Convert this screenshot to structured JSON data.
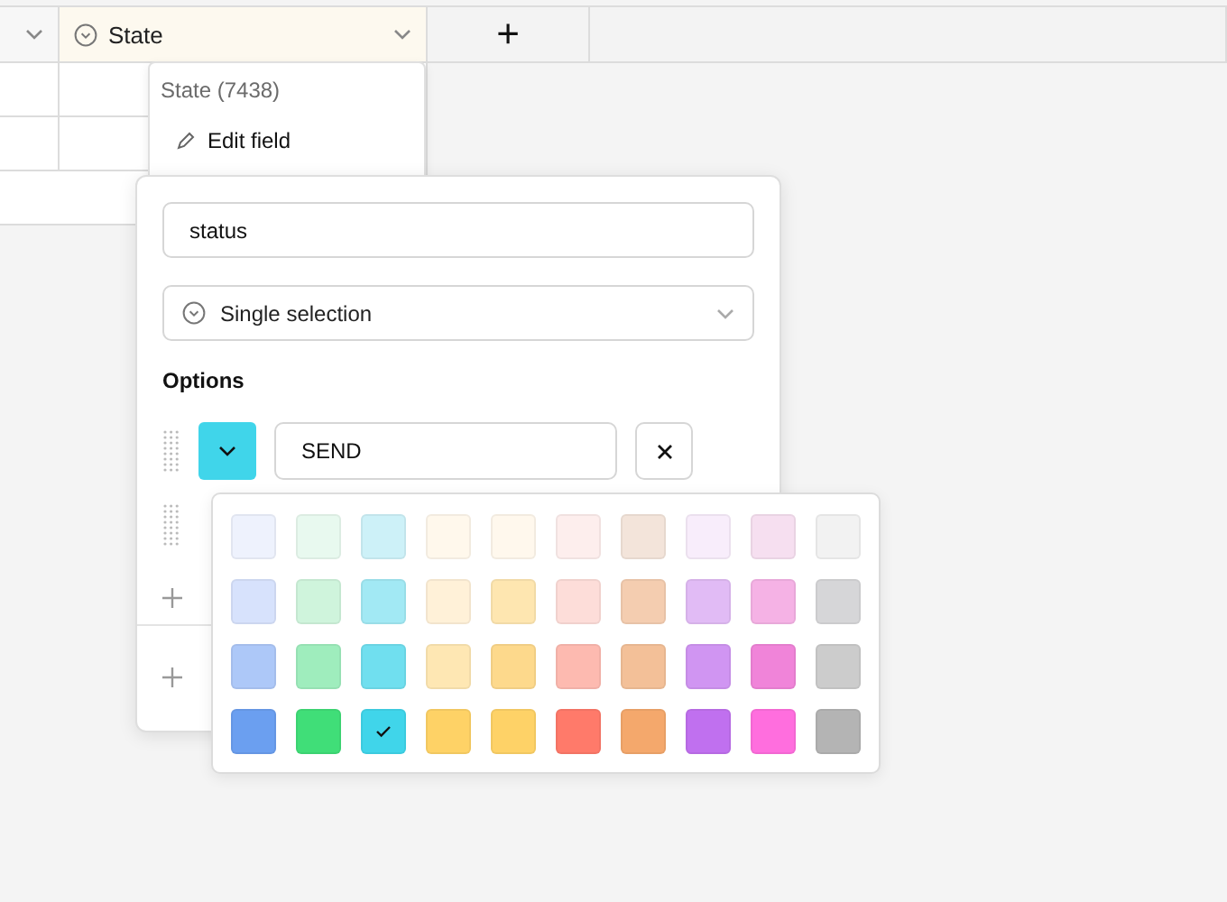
{
  "table": {
    "columns": [
      {
        "kind": "plain"
      },
      {
        "kind": "field",
        "label": "State"
      },
      {
        "kind": "add",
        "label": "+"
      }
    ]
  },
  "column_menu": {
    "title": "State (7438)",
    "items": [
      {
        "label": "Edit field"
      }
    ]
  },
  "field_editor": {
    "name": "status",
    "type": "Single selection",
    "options_heading": "Options",
    "options": [
      {
        "label": "SEND",
        "color": "#40d5ea"
      }
    ],
    "add_buttons": [
      {
        "kind": "option"
      },
      {
        "kind": "section"
      }
    ]
  },
  "color_picker": {
    "rows": [
      [
        {
          "color": "#eef2fd",
          "selected": false
        },
        {
          "color": "#e8f9ef",
          "selected": false
        },
        {
          "color": "#cdf1f8",
          "selected": false
        },
        {
          "color": "#fff8ec",
          "selected": false
        },
        {
          "color": "#fff8ed",
          "selected": false
        },
        {
          "color": "#fdeeed",
          "selected": false
        },
        {
          "color": "#f3e4da",
          "selected": false
        },
        {
          "color": "#f8edfb",
          "selected": false
        },
        {
          "color": "#f6dff0",
          "selected": false
        },
        {
          "color": "#f2f2f2",
          "selected": false
        }
      ],
      [
        {
          "color": "#d7e2fc",
          "selected": false
        },
        {
          "color": "#cff4dc",
          "selected": false
        },
        {
          "color": "#a2e9f4",
          "selected": false
        },
        {
          "color": "#fff1d8",
          "selected": false
        },
        {
          "color": "#fee6b0",
          "selected": false
        },
        {
          "color": "#fdddd9",
          "selected": false
        },
        {
          "color": "#f4cdb0",
          "selected": false
        },
        {
          "color": "#e1bbf5",
          "selected": false
        },
        {
          "color": "#f5b2e5",
          "selected": false
        },
        {
          "color": "#d6d6d8",
          "selected": false
        }
      ],
      [
        {
          "color": "#adc8f8",
          "selected": false
        },
        {
          "color": "#9fedbd",
          "selected": false
        },
        {
          "color": "#70dfef",
          "selected": false
        },
        {
          "color": "#fee7b3",
          "selected": false
        },
        {
          "color": "#fdd98c",
          "selected": false
        },
        {
          "color": "#fdbab0",
          "selected": false
        },
        {
          "color": "#f3c098",
          "selected": false
        },
        {
          "color": "#d095f2",
          "selected": false
        },
        {
          "color": "#f084d9",
          "selected": false
        },
        {
          "color": "#cccccc",
          "selected": false
        }
      ],
      [
        {
          "color": "#6b9ff0",
          "selected": false
        },
        {
          "color": "#40de78",
          "selected": false
        },
        {
          "color": "#40d5ea",
          "selected": true
        },
        {
          "color": "#fed266",
          "selected": false
        },
        {
          "color": "#fed267",
          "selected": false
        },
        {
          "color": "#ff7a6a",
          "selected": false
        },
        {
          "color": "#f4a86c",
          "selected": false
        },
        {
          "color": "#c070ef",
          "selected": false
        },
        {
          "color": "#ff6ede",
          "selected": false
        },
        {
          "color": "#b4b4b4",
          "selected": false
        }
      ]
    ]
  }
}
